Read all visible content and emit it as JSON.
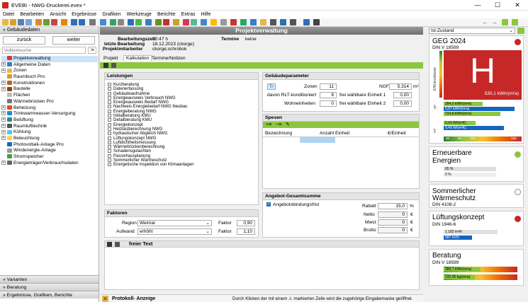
{
  "window": {
    "title": "EVEBI - NWG-Druckerei.evex *"
  },
  "menu": [
    "Datei",
    "Bearbeiten",
    "Ansicht",
    "Ergebnisse",
    "Grafiken",
    "Werkzeuge",
    "Berichte",
    "Extras",
    "Hilfe"
  ],
  "left": {
    "header": "Gebäudedaten",
    "back": "zurück",
    "next": "weiter",
    "search_placeholder": "Volltextsuche",
    "tree": [
      "Projektverwaltung",
      "Allgemeine Daten",
      "Zonen",
      "Raumbuch Pro",
      "Konstruktionen",
      "Bauteile",
      "Flächen",
      "Wärmebrücken Pro",
      "Beheizung",
      "Trinkwarmwasser-Versorgung",
      "Belüftung",
      "Raumlufttechnik",
      "Kühlung",
      "Beleuchtung",
      "Photovoltaik-Anlage Pro",
      "Windenergie-Anlage",
      "Stromspeicher",
      "Energieträger/Verbrauchsdaten"
    ],
    "bottom": [
      "Varianten",
      "Beratung",
      "Ergebnisse, Grafiken, Berichte"
    ]
  },
  "center": {
    "title": "Projektverwaltung",
    "info": {
      "bz_l": "Bearbeitungszeit",
      "bz_v": "00:47 h",
      "lb_l": "letzte Bearbeitung",
      "lb_v": "18.12.2023 (ckorge)",
      "pm_l": "Projektmitarbeiter",
      "pm_v": "ckorge;schrobok",
      "term_l": "Termine",
      "term_v": "keine"
    },
    "tabs": [
      "Projekt",
      "Kalkulation",
      "Termine/Notizen"
    ],
    "leistungen": {
      "title": "Leistungen",
      "items": [
        "Kurzberatung",
        "Datenerfassung",
        "Gebäudeaufnahme",
        "Energieausweis Verbrauch NWG",
        "Energieausweis Bedarf NWG",
        "Nachweis Energiebedarf NWG Neubau",
        "Energieberatung NWG",
        "Initialberatung KMU",
        "Detailberatung KMU",
        "Energiekonzept",
        "Heizlastberechnung NWG",
        "hydraulischer Abgleich NWG",
        "Lüftungskonzept NWG",
        "Luftdichtheitsmessung",
        "Wärmebrückenberechnung",
        "Schadensgutachten",
        "Passivhausplanung",
        "Sommerlicher Wärmeschutz",
        "Energetische Inspektion von Klimaanlagen"
      ]
    },
    "geb": {
      "title": "Gebäudeparameter",
      "zonen_l": "Zonen",
      "zonen_v": "11",
      "ngf_l": "NGF",
      "ngf_v": "5.314",
      "ngf_u": "m²",
      "rlt_l": "davon RLT-konditioniert",
      "rlt_v": "8",
      "fwe1_l": "frei wählbare Einheit 1",
      "fwe1_v": "0,00",
      "we_l": "Wohneinheiten",
      "we_v": "0",
      "fwe2_l": "frei wählbare Einheit 2",
      "fwe2_v": "0,00"
    },
    "spesen": {
      "title": "Spesen",
      "cols": [
        "Bezeichnung",
        "Anzahl Einheit",
        "€/Einheit"
      ]
    },
    "faktoren": {
      "title": "Faktoren",
      "region_l": "Region",
      "region_v": "Weimar",
      "aufwand_l": "Aufwand",
      "aufwand_v": "erhöht",
      "faktor_l": "Faktor",
      "faktor1": "0,90",
      "faktor2": "1,10"
    },
    "angebot": {
      "title": "Angebot-Gesamtsumme",
      "frist": "Angebotsbindungsfrist",
      "rabatt_l": "Rabatt",
      "rabatt_v": "15,0",
      "rabatt_u": "%",
      "netto_l": "Netto",
      "netto_v": "0",
      "mwst_l": "Mwst",
      "mwst_v": "0",
      "brutto_l": "Brutto",
      "brutto_v": "0",
      "eur": "€"
    },
    "freitext": "freier Text",
    "protokoll": {
      "title": "Protokoll- Anzeige",
      "hint": "Durch Klicken der mit einem ⚠ markierten Zeile wird die zugehörige Eingabemaske geöffnet."
    }
  },
  "right": {
    "state": "Ist-Zustand",
    "geg": {
      "t1": "GEG 2024",
      "t2": "DIN V 18599",
      "big": "H",
      "val": "530,1 kWh/(m²a)",
      "side": "Effizienzklasse",
      "scale": [
        "A+",
        "A",
        "B",
        "C",
        "D",
        "E",
        "F",
        "G",
        "H"
      ],
      "bars": [
        "284,0 kWh/(m²a)",
        "0,87 kWh/(m²a)",
        "724,8 kWh/(m²a)",
        "0,43 W/(m²K)",
        "0,49 W/(m²K)"
      ],
      "labs": [
        "QP",
        "QE",
        "HT'",
        "H'T"
      ],
      "ticks": [
        "40",
        "60",
        "100",
        "75",
        "100",
        "166"
      ]
    },
    "ee": {
      "t1": "Erneuerbare",
      "t2": "Energien",
      "b1": "65 %",
      "b2": "0 %"
    },
    "sw": {
      "t1": "Sommerlicher",
      "t2": "Wärmeschutz",
      "t3": "DIN 4108-2"
    },
    "lk": {
      "t1": "Lüftungskonzept",
      "t2": "DIN 1946-6",
      "b1": "1.182 m³/h",
      "b2": "587 m³/h"
    },
    "ber": {
      "t1": "Beratung",
      "t2": "DIN V 18599",
      "b1": "385,7 kWh/(m²a)",
      "b2": "132,45 kg/(m²a)"
    },
    "colors": {
      "green": "#8cc63f",
      "red": "#c62828",
      "blue": "#4a90d9"
    }
  }
}
